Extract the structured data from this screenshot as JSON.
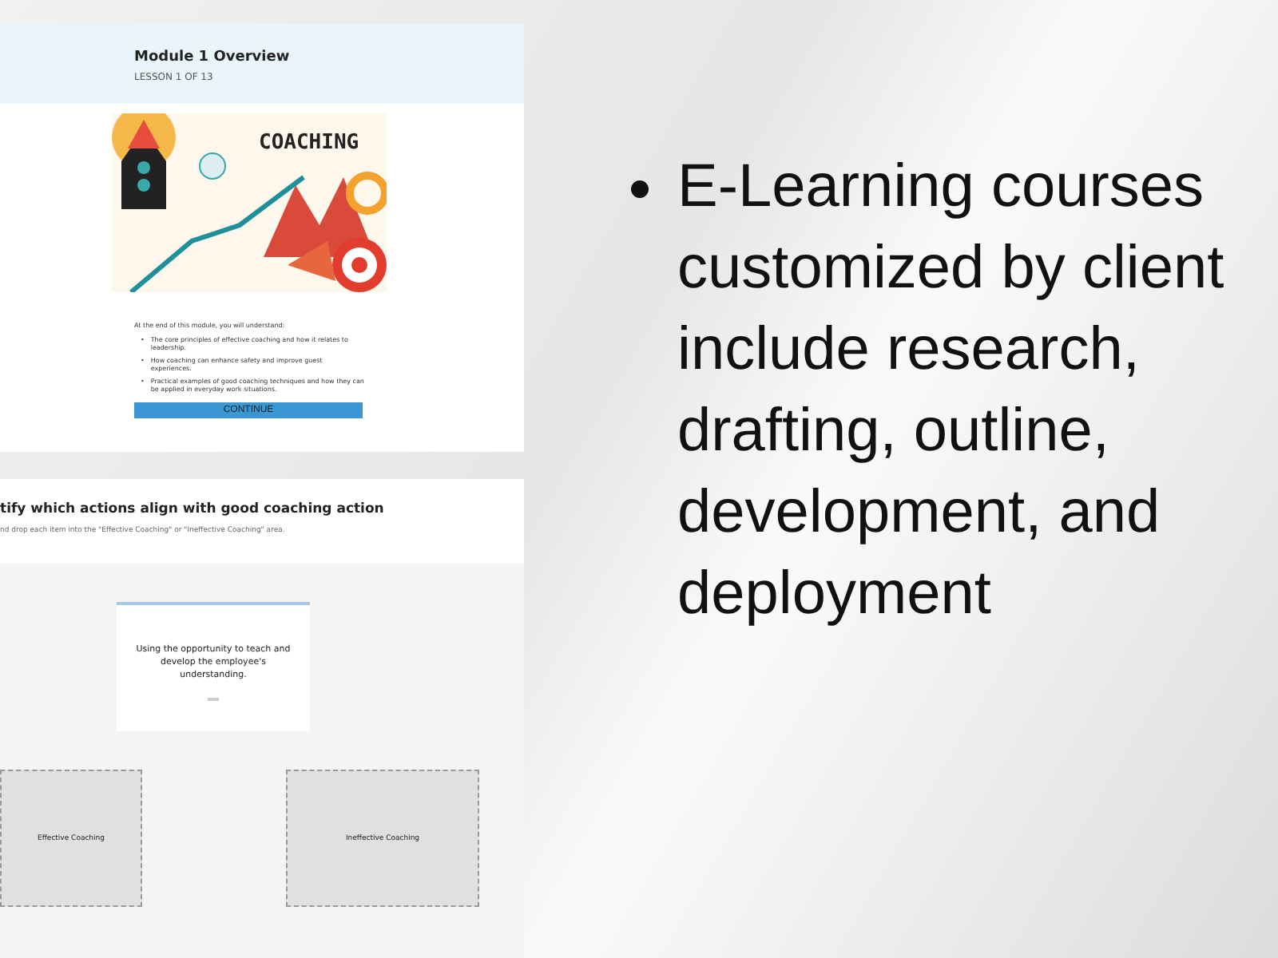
{
  "lesson": {
    "title": "Module 1 Overview",
    "subtitle": "LESSON 1 OF 13",
    "illustration_word": "COACHING",
    "intro": "At the end of this module, you will understand:",
    "points": [
      {
        "marker": "•",
        "text": "The core principles of effective coaching and how it relates to leadership."
      },
      {
        "marker": "•",
        "text": "How coaching can enhance safety and improve guest experiences."
      },
      {
        "marker": "•",
        "text": "Practical examples of good coaching techniques and how they can be applied in everyday work situations."
      }
    ],
    "button": "CONTINUE"
  },
  "activity": {
    "title": "tify which actions align with good coaching action",
    "instruction": "nd drop each item into the \"Effective Coaching\" or \"Ineffective Coaching\" area.",
    "card": "Using the opportunity to teach and develop the employee's understanding.",
    "zones": [
      "Effective Coaching",
      "Ineffective Coaching"
    ]
  },
  "bullets": [
    "E-Learning courses customized by client include research, drafting, outline, development, and deployment"
  ]
}
